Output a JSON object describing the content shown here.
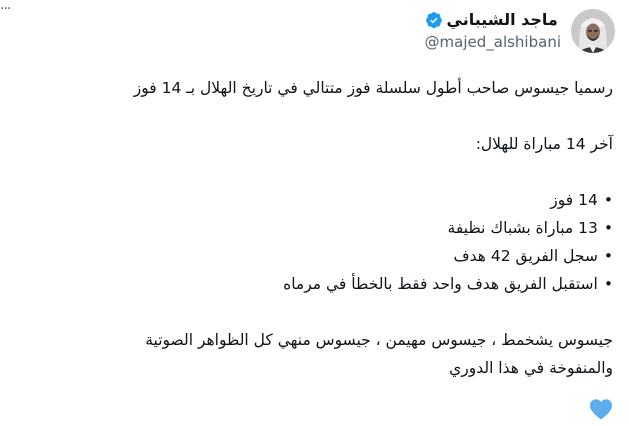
{
  "more_menu": {
    "icon": "more-dots-icon",
    "glyph": "···"
  },
  "author": {
    "display_name": "ماجد الشيباني",
    "handle": "@majed_alshibani",
    "verified": true,
    "verified_color": "#1d9bf0"
  },
  "tweet": {
    "line1": "رسميا جيسوس صاحب أطول سلسلة فوز متتالي في تاريخ الهلال بـ 14 فوز",
    "heading": "آخر 14 مباراة للهلال:",
    "bullets": [
      "14 فوز",
      "13 مباراة بشباك نظيفة",
      "سجل الفريق 42 هدف",
      "استقبل الفريق هدف واحد فقط بالخطأ في مرماه"
    ],
    "closing_line1": "جيسوس يشخمط ، جيسوس مهيمن ، جيسوس منهي كل الظواهر الصوتية",
    "closing_line2": "والمنفوخة في هذا الدوري",
    "emoji": "blue-heart-icon",
    "emoji_color": "#5dadec"
  }
}
